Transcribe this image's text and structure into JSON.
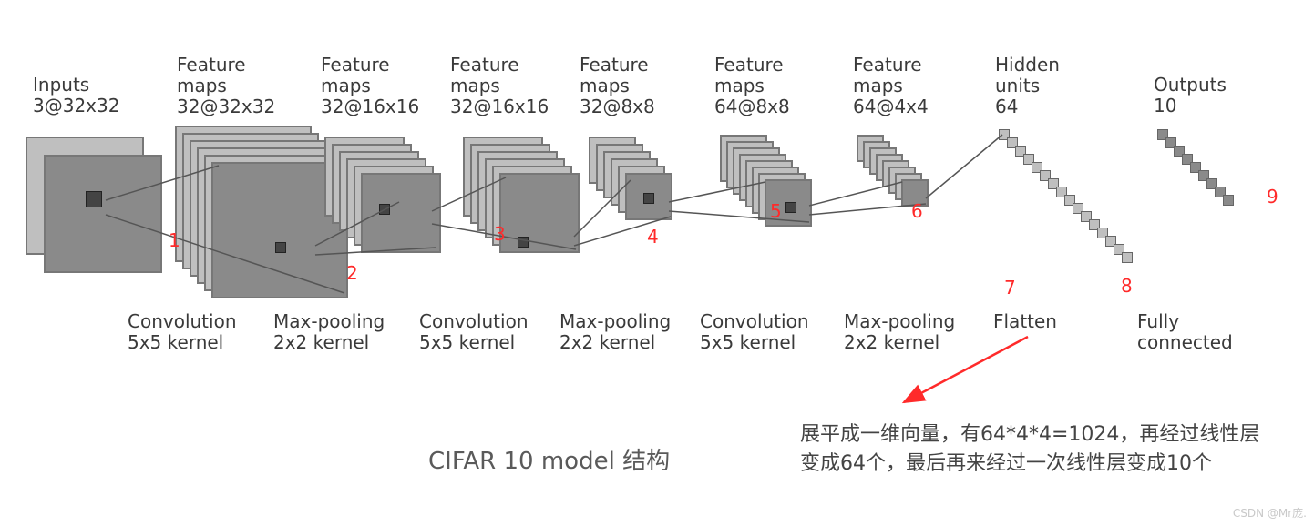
{
  "layers": [
    {
      "id": "inputs",
      "title1": "Inputs",
      "title2": "3@32x32"
    },
    {
      "id": "fmap1",
      "title1": "Feature",
      "title2": "maps",
      "title3": "32@32x32"
    },
    {
      "id": "fmap2",
      "title1": "Feature",
      "title2": "maps",
      "title3": "32@16x16"
    },
    {
      "id": "fmap3",
      "title1": "Feature",
      "title2": "maps",
      "title3": "32@16x16"
    },
    {
      "id": "fmap4",
      "title1": "Feature",
      "title2": "maps",
      "title3": "32@8x8"
    },
    {
      "id": "fmap5",
      "title1": "Feature",
      "title2": "maps",
      "title3": "64@8x8"
    },
    {
      "id": "fmap6",
      "title1": "Feature",
      "title2": "maps",
      "title3": "64@4x4"
    },
    {
      "id": "hidden",
      "title1": "Hidden",
      "title2": "units",
      "title3": "64"
    },
    {
      "id": "outputs",
      "title1": "Outputs",
      "title2": "10"
    }
  ],
  "ops": [
    {
      "id": "op1",
      "line1": "Convolution",
      "line2": "5x5 kernel"
    },
    {
      "id": "op2",
      "line1": "Max-pooling",
      "line2": "2x2 kernel"
    },
    {
      "id": "op3",
      "line1": "Convolution",
      "line2": "5x5 kernel"
    },
    {
      "id": "op4",
      "line1": "Max-pooling",
      "line2": "2x2 kernel"
    },
    {
      "id": "op5",
      "line1": "Convolution",
      "line2": "5x5 kernel"
    },
    {
      "id": "op6",
      "line1": "Max-pooling",
      "line2": "2x2 kernel"
    },
    {
      "id": "op7",
      "line1": "Flatten",
      "line2": ""
    },
    {
      "id": "op8",
      "line1": "Fully",
      "line2": "connected"
    }
  ],
  "red_numbers": [
    "1",
    "2",
    "3",
    "4",
    "5",
    "6",
    "7",
    "8",
    "9"
  ],
  "title": "CIFAR 10 model 结构",
  "note_line1": "展平成一维向量，有64*4*4=1024，再经过线性层",
  "note_line2": "变成64个，最后再来经过一次线性层变成10个",
  "watermark": "CSDN @Mr庞."
}
